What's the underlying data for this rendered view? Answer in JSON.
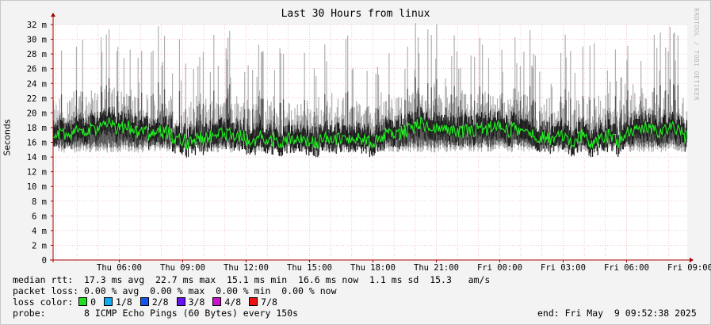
{
  "chart_data": {
    "type": "line",
    "title": "Last 30 Hours from linux",
    "ylabel": "Seconds",
    "ylim": [
      0,
      0.032
    ],
    "y_ticks": [
      {
        "v": 0,
        "label": "0"
      },
      {
        "v": 0.002,
        "label": "2 m"
      },
      {
        "v": 0.004,
        "label": "4 m"
      },
      {
        "v": 0.006,
        "label": "6 m"
      },
      {
        "v": 0.008,
        "label": "8 m"
      },
      {
        "v": 0.01,
        "label": "10 m"
      },
      {
        "v": 0.012,
        "label": "12 m"
      },
      {
        "v": 0.014,
        "label": "14 m"
      },
      {
        "v": 0.016,
        "label": "16 m"
      },
      {
        "v": 0.018,
        "label": "18 m"
      },
      {
        "v": 0.02,
        "label": "20 m"
      },
      {
        "v": 0.022,
        "label": "22 m"
      },
      {
        "v": 0.024,
        "label": "24 m"
      },
      {
        "v": 0.026,
        "label": "26 m"
      },
      {
        "v": 0.028,
        "label": "28 m"
      },
      {
        "v": 0.03,
        "label": "30 m"
      },
      {
        "v": 0.032,
        "label": "32 m"
      }
    ],
    "xlim_hours": [
      0,
      30
    ],
    "x_ticks": [
      {
        "h": 3.13,
        "label": "Thu 06:00"
      },
      {
        "h": 6.13,
        "label": "Thu 09:00"
      },
      {
        "h": 9.13,
        "label": "Thu 12:00"
      },
      {
        "h": 12.13,
        "label": "Thu 15:00"
      },
      {
        "h": 15.13,
        "label": "Thu 18:00"
      },
      {
        "h": 18.13,
        "label": "Thu 21:00"
      },
      {
        "h": 21.13,
        "label": "Fri 00:00"
      },
      {
        "h": 24.13,
        "label": "Fri 03:00"
      },
      {
        "h": 27.13,
        "label": "Fri 06:00"
      },
      {
        "h": 30.13,
        "label": "Fri 09:00"
      }
    ],
    "grid": true,
    "series_colors": {
      "median": "#22ee22",
      "smoke_dark": "#1a1a1a",
      "smoke_mid": "#555555",
      "smoke_light": "#b0b0b0",
      "grid": "#e8a0a0",
      "axis": "#aa0000"
    },
    "median_rtt_ms": {
      "avg": 17.3,
      "max": 22.7,
      "min": 15.1,
      "now": 16.6,
      "sd": 1.1
    }
  },
  "watermark": "RRDTOOL / TOBI OETIKER",
  "legend": {
    "median_rtt": "median rtt:  17.3 ms avg  22.7 ms max  15.1 ms min  16.6 ms now  1.1 ms sd  15.3   am/s",
    "packet_loss": "packet loss: 0.00 % avg  0.00 % max  0.00 % min  0.00 % now",
    "loss_color_label": "loss color:",
    "loss_items": [
      {
        "label": "0",
        "color": "#22dd22"
      },
      {
        "label": "1/8",
        "color": "#11aaee"
      },
      {
        "label": "2/8",
        "color": "#1155ee"
      },
      {
        "label": "3/8",
        "color": "#6611ee"
      },
      {
        "label": "4/8",
        "color": "#cc11cc"
      },
      {
        "label": "7/8",
        "color": "#ee1111"
      }
    ],
    "probe": "probe:       8 ICMP Echo Pings (60 Bytes) every 150s",
    "end": "end: Fri May  9 09:52:38 2025"
  }
}
